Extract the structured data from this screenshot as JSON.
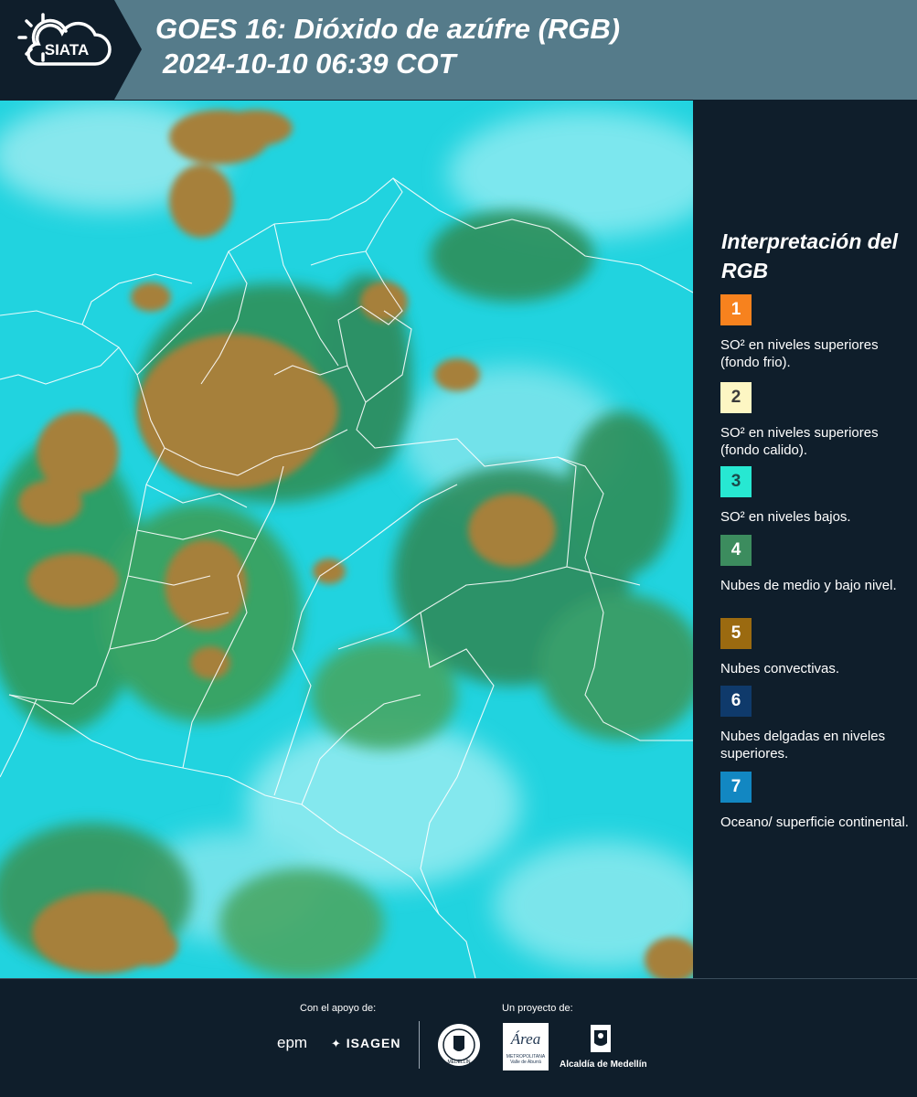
{
  "header": {
    "logo_text": "SIATA",
    "title_line1": "GOES 16: Dióxido de azúfre (RGB)",
    "title_line2": "2024-10-10 06:39 COT",
    "background_color": "#557b8a"
  },
  "legend": {
    "title": "Interpretación del RGB",
    "items": [
      {
        "number": "1",
        "text": "SO² en niveles superiores (fondo frio).",
        "color": "#f7821e"
      },
      {
        "number": "2",
        "text": "SO² en niveles superiores (fondo calido).",
        "color": "#fdf6c3"
      },
      {
        "number": "3",
        "text": "SO² en niveles bajos.",
        "color": "#27e8d2"
      },
      {
        "number": "4",
        "text": "Nubes de medio y bajo nivel.",
        "color": "#3c8c5e"
      },
      {
        "number": "5",
        "text": "Nubes convectivas.",
        "color": "#9b6a10"
      },
      {
        "number": "6",
        "text": "Nubes delgadas en niveles superiores.",
        "color": "#0f3a6b"
      },
      {
        "number": "7",
        "text": "Oceano/ superficie continental.",
        "color": "#1287c2"
      }
    ]
  },
  "map": {
    "background_color": "#22d6e0",
    "icon": "goes16-satellite-rgb-map"
  },
  "footer": {
    "support_label": "Con el apoyo de:",
    "project_label": "Un proyecto de:",
    "sponsors": {
      "epm": "epm",
      "isagen": "ISAGEN",
      "area_name": "Área",
      "area_sub": "METROPOLITANA",
      "area_sub2": "Valle de Aburrá",
      "alcaldia": "Alcaldía de Medellín",
      "seal_text": "MEDELLÍN"
    }
  }
}
